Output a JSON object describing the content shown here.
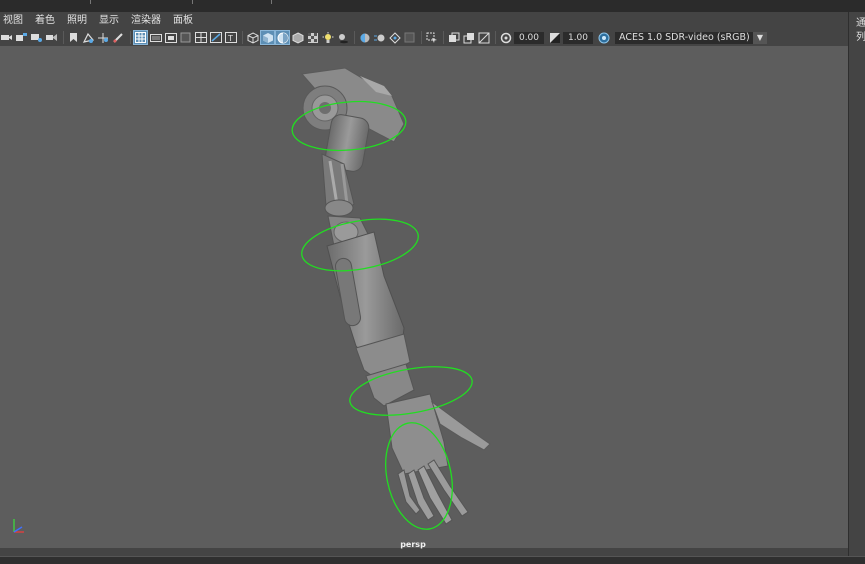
{
  "menubar": {
    "items": [
      "视图",
      "着色",
      "照明",
      "显示",
      "渲染器",
      "面板"
    ]
  },
  "toolbar": {
    "exposure_value": "0.00",
    "gamma_value": "1.00",
    "color_space": "ACES 1.0 SDR-video (sRGB)",
    "icons": [
      "camera-icon",
      "camera-attributes-icon",
      "bookmark-icon",
      "image-plane-icon",
      "grid-icon",
      "film-gate-icon",
      "resolution-gate-icon",
      "wireframe-icon",
      "smooth-shade-icon",
      "textured-icon",
      "lights-icon",
      "shadows-icon",
      "isolate-icon",
      "xray-icon",
      "exposure-icon",
      "gamma-icon",
      "color-management-icon"
    ]
  },
  "viewport": {
    "camera_label": "persp",
    "background_color": "#5d5d5d",
    "control_curve_color": "#22dd22",
    "axis_colors": {
      "x": "#e04040",
      "y": "#40d040",
      "z": "#4070ff"
    }
  },
  "right_panel": {
    "tabs": [
      "通",
      "列"
    ]
  }
}
